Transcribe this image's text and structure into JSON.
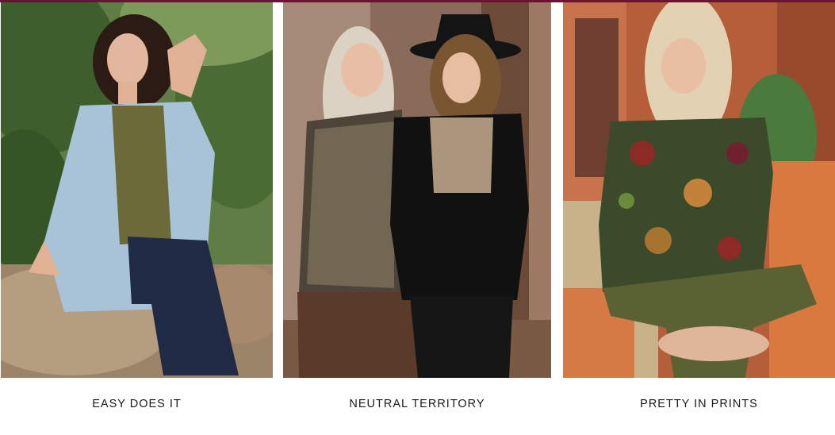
{
  "collections": [
    {
      "label": "EASY DOES IT",
      "scene": "woman in light blue denim shirt over olive tee and dark jeans, seated on rock among green foliage"
    },
    {
      "label": "NEUTRAL TERRITORY",
      "scene": "two women laughing on a porch: one in leopard-print top and brown pants, one in black embroidered blouse and black felt hat"
    },
    {
      "label": "PRETTY IN PRINTS",
      "scene": "woman in multicolor floral print top and olive pants seated on orange wooden chair"
    }
  ],
  "colors": {
    "accent": "#6b1431",
    "caption_text": "#1a1a1a"
  }
}
